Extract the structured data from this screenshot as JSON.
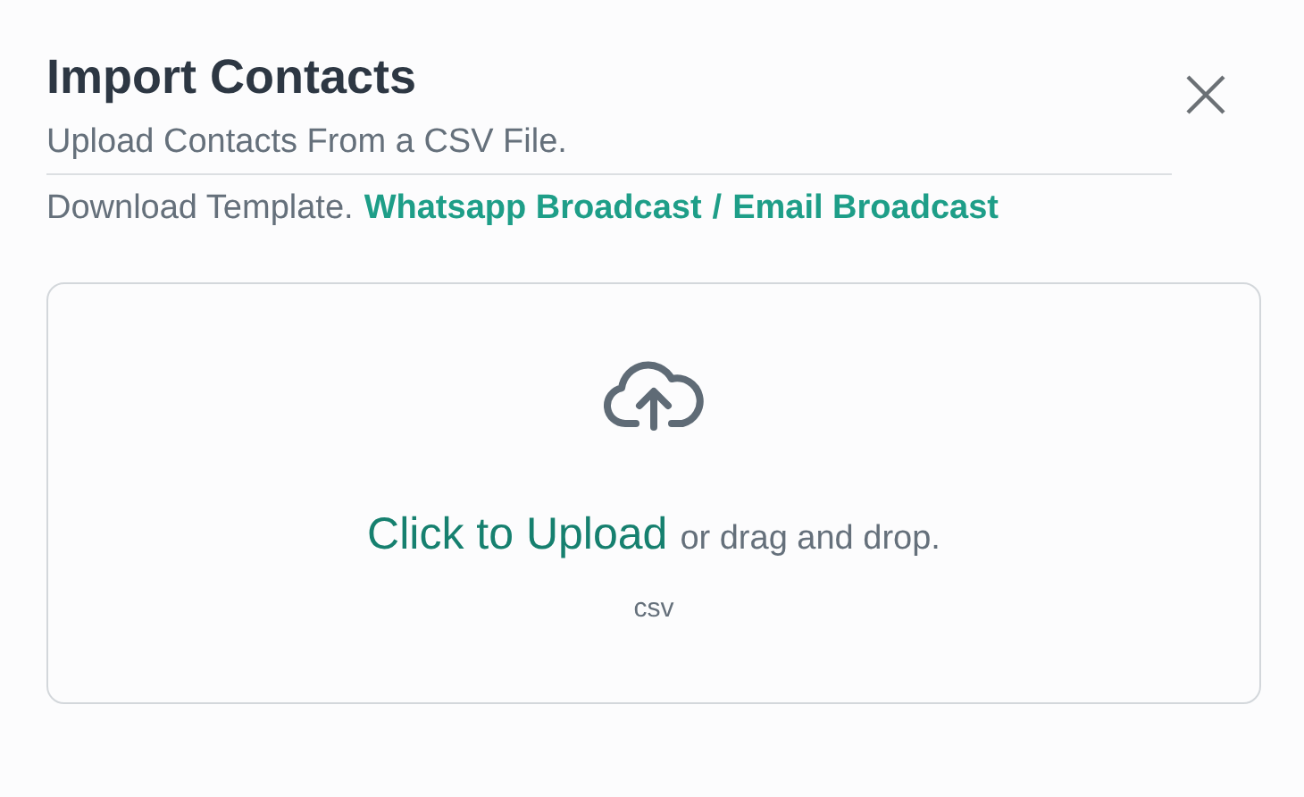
{
  "dialog": {
    "title": "Import Contacts",
    "subtitle": "Upload Contacts From a CSV File.",
    "template_label": "Download Template.",
    "template_links": [
      "Whatsapp Broadcast",
      "Email Broadcast"
    ],
    "link_separator": "/"
  },
  "dropzone": {
    "action": "Click to Upload",
    "hint": "or drag and drop.",
    "formats": "csv"
  }
}
